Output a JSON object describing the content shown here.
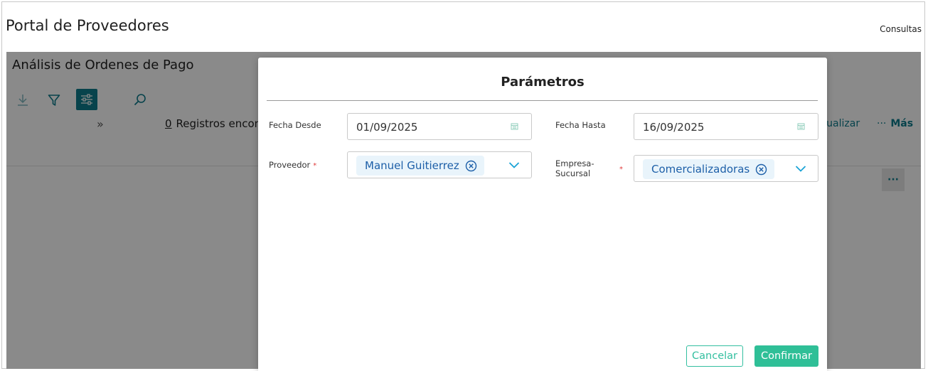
{
  "app": {
    "title": "Portal de Proveedores",
    "nav_consultas": "Consultas"
  },
  "page": {
    "title": "Análisis de Ordenes de Pago",
    "records_count": "0",
    "records_text": "Registros encon",
    "actualizar_label": "ctualizar",
    "mas_label": "Más",
    "mas_dots": "···",
    "row_more": "···",
    "expand_glyph": "»"
  },
  "modal": {
    "title": "Parámetros",
    "fecha_desde": {
      "label": "Fecha Desde",
      "value": "01/09/2025"
    },
    "fecha_hasta": {
      "label": "Fecha Hasta",
      "value": "16/09/2025"
    },
    "proveedor": {
      "label": "Proveedor",
      "required_mark": "*",
      "selected": "Manuel Guitierrez"
    },
    "empresa": {
      "label_line1": "Empresa-",
      "label_line2": "Sucursal",
      "required_mark": "*",
      "selected": "Comercializadoras"
    },
    "cancel_label": "Cancelar",
    "confirm_label": "Confirmar"
  },
  "colors": {
    "accent": "#0e7c8c",
    "confirm": "#2fbf97",
    "chip_bg": "#e9f4fb",
    "chip_text": "#1d5fa8",
    "required": "#e03b3b"
  },
  "icons": [
    "download-icon",
    "filter-icon",
    "parameters-icon",
    "search-icon",
    "calendar-icon",
    "remove-chip-icon",
    "chevron-down-icon"
  ]
}
